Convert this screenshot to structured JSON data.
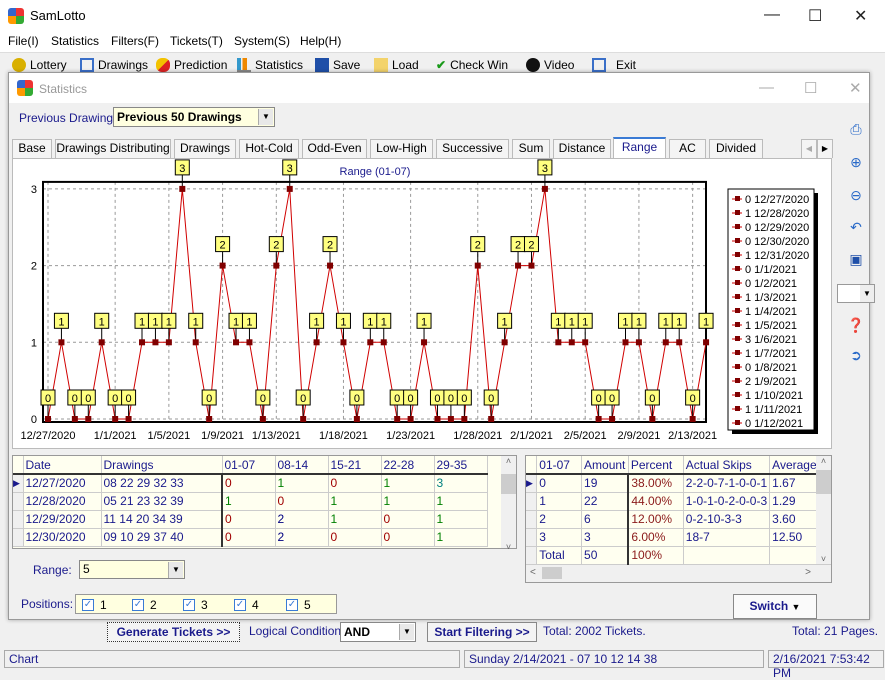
{
  "app": {
    "title": "SamLotto"
  },
  "menu": [
    "File(I)",
    "Statistics",
    "Filters(F)",
    "Tickets(T)",
    "System(S)",
    "Help(H)"
  ],
  "toolbar": [
    {
      "label": "Lottery",
      "icon": "lottery-ball-icon"
    },
    {
      "label": "Drawings",
      "icon": "drawings-list-icon"
    },
    {
      "label": "Prediction",
      "icon": "prediction-pill-icon"
    },
    {
      "label": "Statistics",
      "icon": "bar-chart-icon"
    },
    {
      "label": "Save",
      "icon": "floppy-disk-icon"
    },
    {
      "label": "Load",
      "icon": "folder-open-icon"
    },
    {
      "label": "Check Win",
      "icon": "checkmark-icon"
    },
    {
      "label": "Video",
      "icon": "play-icon"
    },
    {
      "label": "Exit",
      "icon": "exit-door-icon"
    }
  ],
  "stats_window": {
    "title": "Statistics",
    "prev_label": "Previous Drawings:",
    "prev_value": "Previous 50 Drawings",
    "tabs": [
      "Base",
      "Drawings Distributing",
      "Drawings",
      "Hot-Cold",
      "Odd-Even",
      "Low-High",
      "Successive",
      "Sum",
      "Distance",
      "Range",
      "AC",
      "Divided"
    ],
    "active_tab": "Range",
    "side_tools": [
      "printer-icon",
      "zoom-in-icon",
      "zoom-out-icon",
      "undo-icon",
      "save-icon",
      "color-picker",
      "help-icon",
      "exit-icon"
    ]
  },
  "chart_data": {
    "type": "line",
    "title": "Range (01-07)",
    "ylim": [
      0,
      3
    ],
    "y_ticks": [
      "0",
      "1",
      "2",
      "3"
    ],
    "grid": true,
    "legend": "right",
    "line_color": "#d00000",
    "marker_color": "#800000",
    "x": [
      "12/27/2020",
      "12/28/2020",
      "12/29/2020",
      "12/30/2020",
      "12/31/2020",
      "1/1/2021",
      "1/2/2021",
      "1/3/2021",
      "1/4/2021",
      "1/5/2021",
      "1/6/2021",
      "1/7/2021",
      "1/8/2021",
      "1/9/2021",
      "1/10/2021",
      "1/11/2021",
      "1/12/2021",
      "1/13/2021",
      "1/14/2021",
      "1/15/2021",
      "1/16/2021",
      "1/17/2021",
      "1/18/2021",
      "1/19/2021",
      "1/20/2021",
      "1/21/2021",
      "1/22/2021",
      "1/23/2021",
      "1/24/2021",
      "1/25/2021",
      "1/26/2021",
      "1/27/2021",
      "1/28/2021",
      "1/29/2021",
      "1/30/2021",
      "1/31/2021",
      "2/1/2021",
      "2/2/2021",
      "2/3/2021",
      "2/4/2021",
      "2/5/2021",
      "2/6/2021",
      "2/7/2021",
      "2/8/2021",
      "2/9/2021",
      "2/10/2021",
      "2/11/2021",
      "2/12/2021",
      "2/13/2021",
      "2/14/2021"
    ],
    "values": [
      0,
      1,
      0,
      0,
      1,
      0,
      0,
      1,
      1,
      1,
      3,
      1,
      0,
      2,
      1,
      1,
      0,
      2,
      3,
      0,
      1,
      2,
      1,
      0,
      1,
      1,
      0,
      0,
      1,
      0,
      0,
      0,
      2,
      0,
      1,
      2,
      2,
      3,
      1,
      1,
      1,
      0,
      0,
      1,
      1,
      0,
      1,
      1,
      0,
      1
    ],
    "x_ticks": [
      "12/27/2020",
      "1/1/2021",
      "1/5/2021",
      "1/9/2021",
      "1/13/2021",
      "1/18/2021",
      "1/23/2021",
      "1/28/2021",
      "2/1/2021",
      "2/5/2021",
      "2/9/2021",
      "2/13/2021"
    ],
    "legend_entries": [
      "0 12/27/2020",
      "1 12/28/2020",
      "0 12/29/2020",
      "0 12/30/2020",
      "1 12/31/2020",
      "0 1/1/2021",
      "0 1/2/2021",
      "1 1/3/2021",
      "1 1/4/2021",
      "1 1/5/2021",
      "3 1/6/2021",
      "1 1/7/2021",
      "0 1/8/2021",
      "2 1/9/2021",
      "1 1/10/2021",
      "1 1/11/2021",
      "0 1/12/2021"
    ]
  },
  "drawings_table": {
    "headers": [
      "Date",
      "Drawings",
      "01-07",
      "08-14",
      "15-21",
      "22-28",
      "29-35"
    ],
    "rows": [
      [
        "12/27/2020",
        "08 22 29 32 33",
        "0",
        "1",
        "0",
        "1",
        "3"
      ],
      [
        "12/28/2020",
        "05 21 23 32 39",
        "1",
        "0",
        "1",
        "1",
        "1"
      ],
      [
        "12/29/2020",
        "11 14 20 34 39",
        "0",
        "2",
        "1",
        "0",
        "1"
      ],
      [
        "12/30/2020",
        "09 10 29 37 40",
        "0",
        "2",
        "0",
        "0",
        "1"
      ]
    ]
  },
  "summary_table": {
    "headers": [
      "01-07",
      "Amount",
      "Percent",
      "Actual Skips",
      "Average S"
    ],
    "rows": [
      [
        "0",
        "19",
        "38.00%",
        "2-2-0-7-1-0-0-1",
        "1.67"
      ],
      [
        "1",
        "22",
        "44.00%",
        "1-0-1-0-2-0-0-3",
        "1.29"
      ],
      [
        "2",
        "6",
        "12.00%",
        "0-2-10-3-3",
        "3.60"
      ],
      [
        "3",
        "3",
        "6.00%",
        "18-7",
        "12.50"
      ],
      [
        "Total",
        "50",
        "100%",
        "",
        ""
      ]
    ]
  },
  "range": {
    "label": "Range:",
    "value": "5"
  },
  "positions": {
    "label": "Positions:",
    "items": [
      "1",
      "2",
      "3",
      "4",
      "5"
    ]
  },
  "switch_label": "Switch",
  "bottom": {
    "generate": "Generate Tickets >>",
    "logical_label": "Logical Condition:",
    "logical_value": "AND",
    "start_filter": "Start Filtering >>",
    "total_tickets": "Total: 2002 Tickets.",
    "total_pages": "Total: 21 Pages."
  },
  "status": {
    "left": "Chart",
    "middle": "Sunday 2/14/2021 - 07 10 12 14 38",
    "right": "2/16/2021 7:53:42 PM"
  }
}
